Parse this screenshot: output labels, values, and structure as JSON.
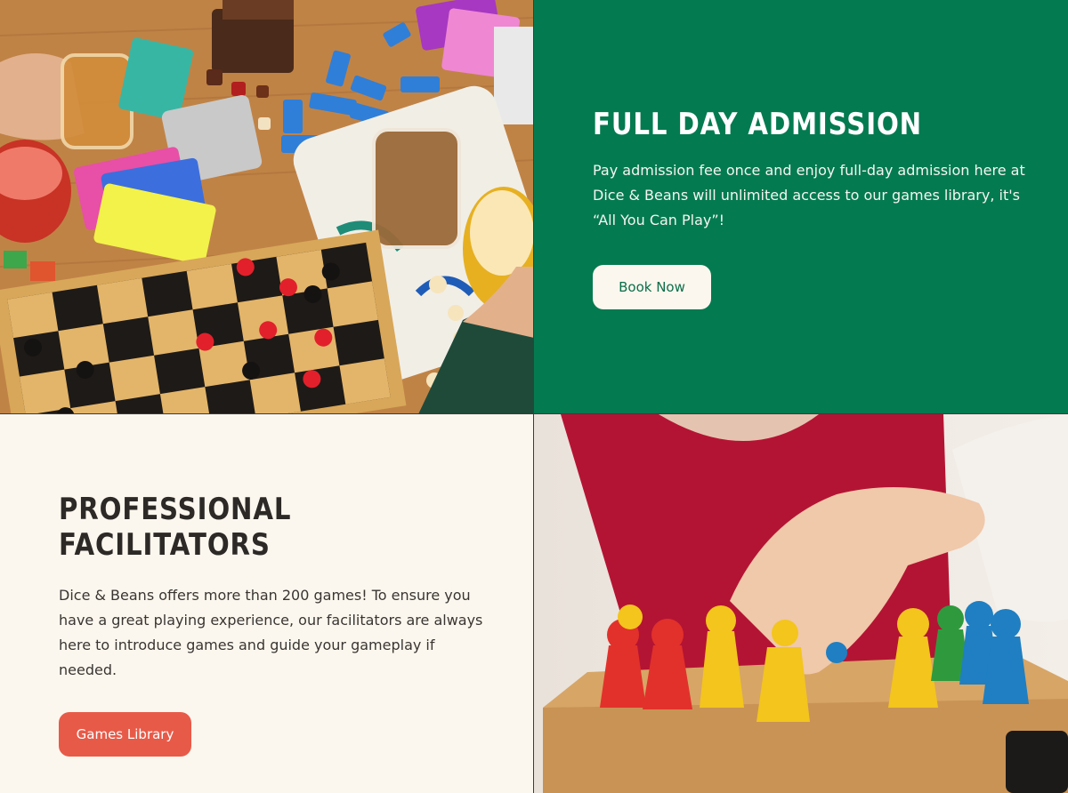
{
  "admission": {
    "title": "FULL DAY ADMISSION",
    "description": "Pay admission fee once and enjoy full-day admission here at Dice & Beans will unlimited access to our games library, it's “All You Can Play”!",
    "button_label": "Book Now"
  },
  "facilitators": {
    "title_line1": "PROFESSIONAL",
    "title_line2": "FACILITATORS",
    "description": "Dice & Beans offers more than 200 games! To ensure you have a great playing experience, our facilitators are always here to introduce games and guide your gameplay if needed.",
    "button_label": "Games Library"
  },
  "colors": {
    "green_panel": "#047a50",
    "cream_panel": "#fcf7ee",
    "book_button_bg": "#fcf7ee",
    "games_button_bg": "#e85a48"
  },
  "icons": [
    "board-games-table-photo",
    "board-game-pieces-photo"
  ]
}
